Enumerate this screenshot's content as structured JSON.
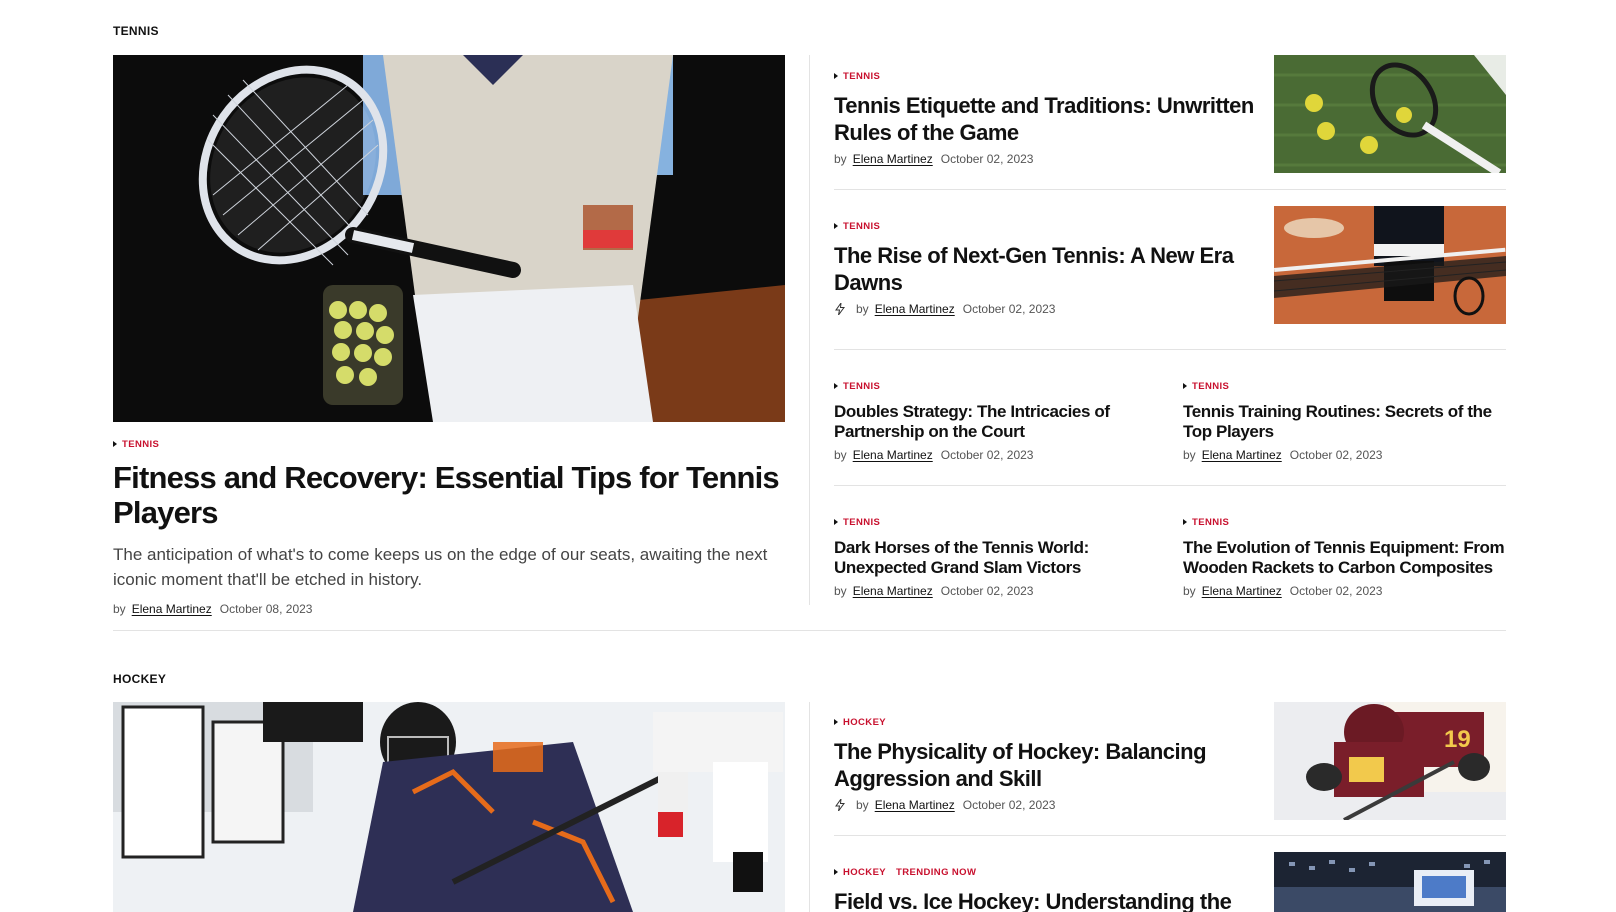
{
  "tennis": {
    "section_label": "TENNIS",
    "featured": {
      "category": "TENNIS",
      "title": "Fitness and Recovery: Essential Tips for Tennis Players",
      "excerpt": "The anticipation of what's to come keeps us on the edge of our seats, awaiting the next iconic moment that'll be etched in history.",
      "by": "by",
      "author": "Elena Martinez",
      "date": "October 08, 2023"
    },
    "side": [
      {
        "category": "TENNIS",
        "title": "Tennis Etiquette and Traditions: Unwritten Rules of the Game",
        "by": "by",
        "author": "Elena Martinez",
        "date": "October 02, 2023"
      },
      {
        "category": "TENNIS",
        "title": "The Rise of Next-Gen Tennis: A New Era Dawns",
        "by": "by",
        "author": "Elena Martinez",
        "date": "October 02, 2023",
        "icon": "bolt-icon"
      }
    ],
    "grid": [
      {
        "category": "TENNIS",
        "title": "Doubles Strategy: The Intricacies of Partnership on the Court",
        "by": "by",
        "author": "Elena Martinez",
        "date": "October 02, 2023"
      },
      {
        "category": "TENNIS",
        "title": "Tennis Training Routines: Secrets of the Top Players",
        "by": "by",
        "author": "Elena Martinez",
        "date": "October 02, 2023"
      },
      {
        "category": "TENNIS",
        "title": "Dark Horses of the Tennis World: Unexpected Grand Slam Victors",
        "by": "by",
        "author": "Elena Martinez",
        "date": "October 02, 2023"
      },
      {
        "category": "TENNIS",
        "title": "The Evolution of Tennis Equipment: From Wooden Rackets to Carbon Composites",
        "by": "by",
        "author": "Elena Martinez",
        "date": "October 02, 2023"
      }
    ]
  },
  "hockey": {
    "section_label": "HOCKEY",
    "side": [
      {
        "category": "HOCKEY",
        "title": "The Physicality of Hockey: Balancing Aggression and Skill",
        "by": "by",
        "author": "Elena Martinez",
        "date": "October 02, 2023",
        "icon": "bolt-icon"
      },
      {
        "category": "HOCKEY",
        "extra_tag": "TRENDING NOW",
        "title": "Field vs. Ice Hockey: Understanding the"
      }
    ]
  },
  "colors": {
    "accent": "#c8102e",
    "text": "#111111",
    "muted": "#555555",
    "divider": "#e3e3e3"
  }
}
